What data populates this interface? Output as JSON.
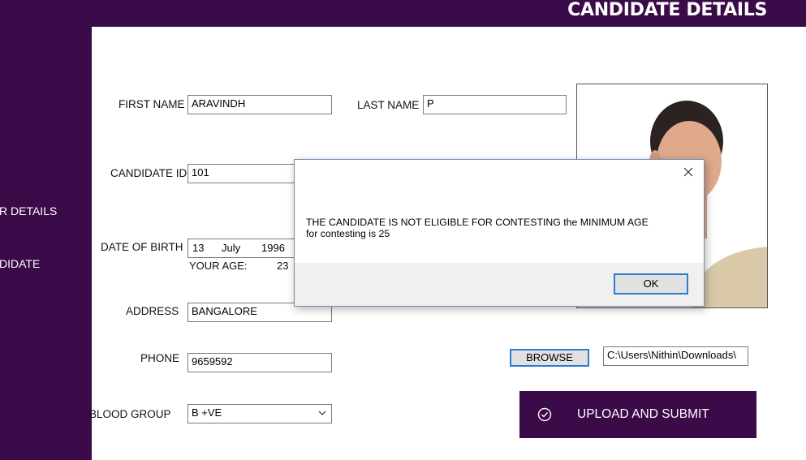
{
  "header": {
    "title": "CANDIDATE DETAILS"
  },
  "sidebar": {
    "items": [
      {
        "label": "R DETAILS"
      },
      {
        "label": "DIDATE"
      }
    ]
  },
  "form": {
    "first_name": {
      "label": "FIRST NAME",
      "value": "ARAVINDH"
    },
    "last_name": {
      "label": "LAST NAME",
      "value": "P"
    },
    "candidate_id": {
      "label": "CANDIDATE ID",
      "value": "101"
    },
    "dob": {
      "label": "DATE OF BIRTH",
      "day": "13",
      "month": "July",
      "year": "1996"
    },
    "age": {
      "label": "YOUR AGE:",
      "value": "23"
    },
    "address": {
      "label": "ADDRESS",
      "value": "BANGALORE"
    },
    "phone": {
      "label": "PHONE",
      "value": "9659592"
    },
    "blood_group": {
      "label": "BLOOD GROUP",
      "value": "B +VE"
    }
  },
  "photo": {
    "browse_label": "BROWSE",
    "path": "C:\\Users\\Nithin\\Downloads\\"
  },
  "upload": {
    "label": "UPLOAD AND SUBMIT"
  },
  "dialog": {
    "line1": "THE CANDIDATE IS NOT ELIGIBLE FOR CONTESTING  the MINIMUM AGE",
    "line2": "for contesting is 25",
    "ok_label": "OK"
  },
  "colors": {
    "brand": "#3b0a48",
    "focus": "#2b7bd1"
  }
}
